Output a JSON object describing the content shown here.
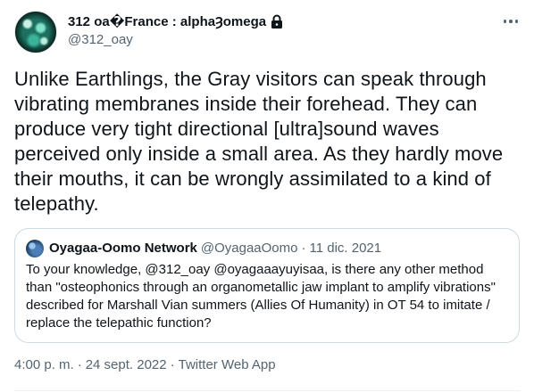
{
  "author": {
    "display_name": "312 oa�France : alphaȜomega",
    "handle": "@312_oay",
    "icon": "lock-icon"
  },
  "tweet": {
    "text": "Unlike Earthlings, the Gray visitors can speak through vibrating membranes inside their forehead. They can produce very tight directional [ultra]sound waves perceived only inside a small area. As they hardly move their mouths, it can be wrongly assimilated to a kind of telepathy.",
    "time": "4:00 p. m.",
    "date": "24 sept. 2022",
    "source": "Twitter Web App",
    "separator": "·"
  },
  "quote": {
    "display_name": "Oyagaa-Oomo Network",
    "handle": "@OyagaaOomo",
    "separator": "·",
    "date": "11 dic. 2021",
    "text": "To your knowledge, @312_oay @oyagaaayuyisaa, is there any other method than \"osteophonics through an organometallic jaw implant to amplify vibrations\" described for Marshall Vian summers (Allies Of Humanity) in OT 54 to imitate / replace the telepathic function?"
  },
  "colors": {
    "text": "#0f1419",
    "secondary": "#536471",
    "border": "#cfd9de"
  }
}
